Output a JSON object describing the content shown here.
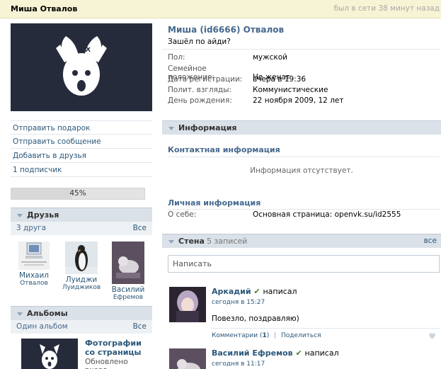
{
  "header": {
    "name": "Миша Отвалов",
    "last_seen": "был в сети 38 минут назад"
  },
  "left": {
    "menu": [
      {
        "label": "Отправить подарок"
      },
      {
        "label": "Отправить сообщение"
      },
      {
        "label": "Добавить в друзья"
      },
      {
        "label": "1 подписчик"
      }
    ],
    "progress": {
      "label": "45%",
      "value": 45
    },
    "friends": {
      "title": "Друзья",
      "count_label": "3 друга",
      "all_label": "Все",
      "items": [
        {
          "first": "Михаил",
          "last": "Отвалов"
        },
        {
          "first": "Луиджи",
          "last": "Луиджиков"
        },
        {
          "first": "Василий",
          "last": "Ефремов"
        }
      ]
    },
    "albums": {
      "title": "Альбомы",
      "count_label": "Один альбом",
      "all_label": "Все",
      "item": {
        "title": "Фотографии со страницы",
        "updated": "Обновлено вчера"
      }
    }
  },
  "profile": {
    "name": "Миша (id6666) Отвалов",
    "status": "Зашёл по айди?",
    "fields": [
      {
        "label": "Пол:",
        "value": "мужской"
      },
      {
        "label": "Семейное положение:",
        "value": "Не женат"
      },
      {
        "label": "Дата регистрации:",
        "value": "вчера в 19:36"
      },
      {
        "label": "Полит. взгляды:",
        "value": "Коммунистические"
      },
      {
        "label": "День рождения:",
        "value": "22 ноября 2009, 12 лет"
      }
    ]
  },
  "info": {
    "title": "Информация",
    "contact_title": "Контактная информация",
    "empty_text": "Информация отсутствует.",
    "personal_title": "Личная информация",
    "about_label": "О себе:",
    "about_value": "Основная страница: openvk.su/id2555"
  },
  "wall": {
    "title": "Стена",
    "count": "5 записей",
    "all_label": "все",
    "placeholder": "Написать",
    "posts": [
      {
        "author": "Аркадий",
        "action": "написал",
        "time": "сегодня в 15:27",
        "text": "Повезло, поздравляю)",
        "comments": "Комментарии",
        "comments_count": "1",
        "share": "Поделиться"
      },
      {
        "author": "Василий Ефремов",
        "action": "написал",
        "time": "сегодня в 11:17"
      }
    ]
  },
  "colors": {
    "link": "#2b587a",
    "header_bg": "#f7f4d5",
    "section_bg": "#dae1e8",
    "avatar_bg": "#262b3c"
  }
}
